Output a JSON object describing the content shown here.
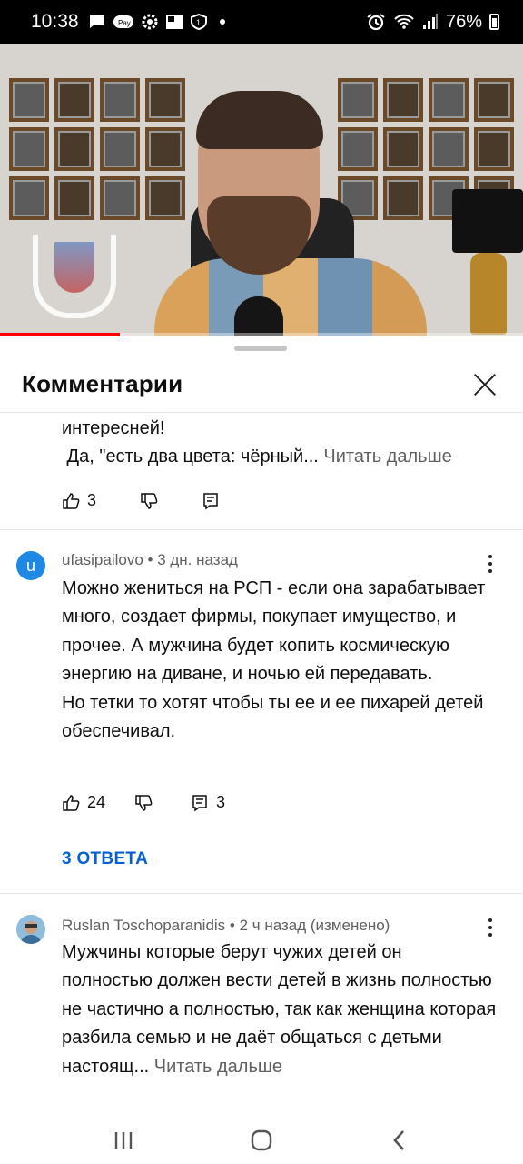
{
  "status_bar": {
    "time": "10:38",
    "battery": "76%",
    "icons": [
      "message-icon",
      "pay-icon",
      "settings-icon",
      "gallery-icon",
      "shield-icon",
      "alarm-icon",
      "wifi-icon",
      "signal-icon",
      "battery-icon"
    ]
  },
  "video": {
    "progress_fraction": 0.23,
    "progress_color": "#ff0000"
  },
  "sheet": {
    "title": "Комментарии"
  },
  "comments": [
    {
      "text_lines": [
        "интересней!",
        " Да, \"есть два цвета: чёрный... "
      ],
      "read_more": "Читать дальше",
      "likes": "3",
      "reply_count": ""
    },
    {
      "author": "ufasipailovo",
      "time": "3 дн. назад",
      "avatar_letter": "u",
      "avatar_color": "#1e88e5",
      "text": "Можно жениться на РСП - если она зарабатывает много, создает фирмы, покупает имущество, и прочее. А мужчина будет копить космическую энергию на диване, и ночью ей передавать.\nНо тетки то хотят чтобы ты ее и ее пихарей детей обеспечивал.",
      "likes": "24",
      "reply_count": "3",
      "replies_label": "3 ОТВЕТА"
    },
    {
      "author": "Ruslan Toschoparanidis",
      "time": "2 ч назад (изменено)",
      "text": "Мужчины которые берут чужих детей он полностью должен вести детей в жизнь полностью не частично а полностью, так как женщина которая разбила семью и не даёт общаться с детьми настоящ... ",
      "read_more": "Читать дальше"
    }
  ],
  "colors": {
    "link": "#065fd4",
    "secondary_text": "#606060"
  },
  "nav": [
    "recents-icon",
    "home-icon",
    "back-icon"
  ]
}
